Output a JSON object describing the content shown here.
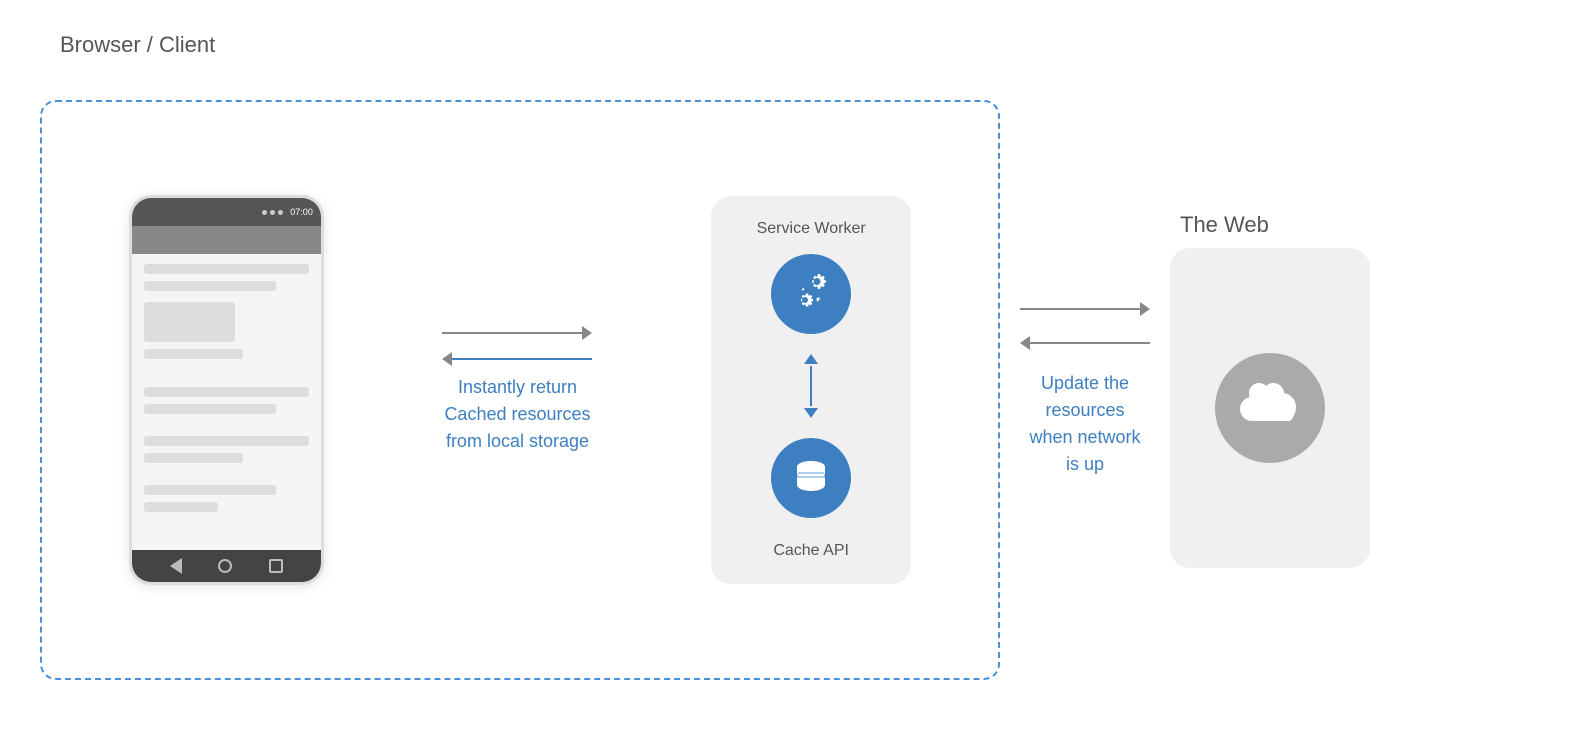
{
  "diagram": {
    "browser_client_label": "Browser / Client",
    "the_web_label": "The Web",
    "service_worker_label": "Service Worker",
    "cache_api_label": "Cache API",
    "instantly_return_line1": "Instantly return",
    "cached_resources_line2": "Cached resources",
    "from_local_storage_line3": "from local storage",
    "update_the_line1": "Update the",
    "resources_line2": "resources",
    "when_network_line3": "when network",
    "is_up_line4": "is up"
  }
}
